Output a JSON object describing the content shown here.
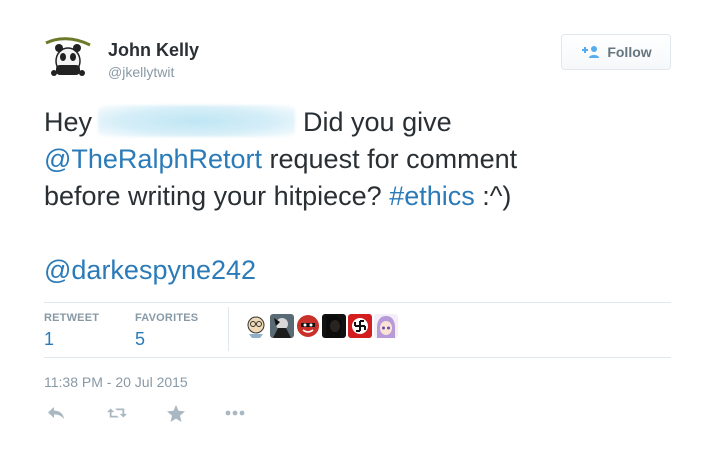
{
  "author": {
    "name": "John Kelly",
    "handle": "@jkellytwit"
  },
  "follow_button": {
    "label": "Follow",
    "icon": "follow-user-plus-icon"
  },
  "tweet": {
    "line1_start": "Hey",
    "line1_end": "Did you give",
    "mention1": "@TheRalphRetort",
    "line2_end": " request for comment",
    "line3_start": "before writing your hitpiece? ",
    "hashtag": "#ethics",
    "line3_end": " :^)",
    "mention2": "@darkespyne242"
  },
  "stats": {
    "retweet_label": "RETWEET",
    "retweet_count": "1",
    "favorites_label": "FAVORITES",
    "favorites_count": "5"
  },
  "favoriters": [
    {
      "icon": "cartoon-face-avatar-icon"
    },
    {
      "icon": "dark-character-avatar-icon"
    },
    {
      "icon": "red-masked-avatar-icon"
    },
    {
      "icon": "black-hair-avatar-icon"
    },
    {
      "icon": "red-symbol-avatar-icon"
    },
    {
      "icon": "anime-girl-avatar-icon"
    }
  ],
  "timestamp": "11:38 PM - 20 Jul 2015",
  "actions": [
    {
      "icon": "reply-icon"
    },
    {
      "icon": "retweet-icon"
    },
    {
      "icon": "favorite-star-icon"
    },
    {
      "icon": "more-dots-icon"
    }
  ],
  "colors": {
    "link": "#2b7bb9",
    "text": "#292f33",
    "muted": "#8899a6",
    "border": "#e1e8ed"
  }
}
